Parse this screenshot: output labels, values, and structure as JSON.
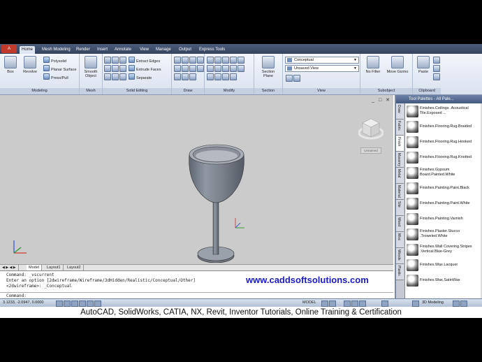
{
  "app": {
    "app_button": "A",
    "tabs": [
      {
        "label": "Home"
      },
      {
        "label": "Mesh Modeling"
      },
      {
        "label": "Render"
      },
      {
        "label": "Insert"
      },
      {
        "label": "Annotate"
      },
      {
        "label": "View"
      },
      {
        "label": "Manage"
      },
      {
        "label": "Output"
      },
      {
        "label": "Express Tools"
      }
    ]
  },
  "ribbon": {
    "modeling": {
      "title": "Modeling",
      "box": "Box",
      "revolve": "Revolve",
      "polysolid": "Polysolid",
      "planar_surface": "Planar Surface",
      "presspull": "Press/Pull"
    },
    "mesh": {
      "title": "Mesh",
      "smooth_object_line1": "Smooth",
      "smooth_object_line2": "Object"
    },
    "solid_editing": {
      "title": "Solid Editing",
      "extract_edges": "Extract Edges",
      "extrude_faces": "Extrude Faces",
      "separate": "Separate"
    },
    "draw": {
      "title": "Draw"
    },
    "modify": {
      "title": "Modify"
    },
    "section": {
      "title": "Section",
      "section_plane_line1": "Section",
      "section_plane_line2": "Plane"
    },
    "view": {
      "title": "View",
      "visual_style": "Conceptual",
      "saved_view": "Unsaved View"
    },
    "subobject": {
      "title": "Subobject",
      "no_filter": "No Filter",
      "move_gizmo": "Move Gizmo"
    },
    "clipboard": {
      "title": "Clipboard",
      "paste": "Paste"
    }
  },
  "viewport": {
    "doc_controls": "_ □ ✕",
    "viewcube_label": "Unnamed"
  },
  "layout_tabs": [
    {
      "label": "Model"
    },
    {
      "label": "Layout1"
    },
    {
      "label": "Layout2"
    }
  ],
  "command": {
    "lines": [
      "Command: _vscurrent",
      "Enter an option [2dwireframe/Wireframe/3dHidden/Realistic/Conceptual/Other]",
      "<2dwireframe>: _Conceptual"
    ],
    "prompt": "Command:"
  },
  "watermark": "www.caddsoftsolutions.com",
  "status": {
    "coords": "3.1233, -2.0947, 0.0000",
    "model": "MODEL",
    "workspace": "3D Modeling"
  },
  "palette": {
    "title": "Tool Palettes - All Pale...",
    "tabs": [
      "Draw",
      "Fabric",
      "Finish",
      "Masonry",
      "Metal",
      "Material",
      "Site",
      "Wood",
      "Misc",
      "Woods",
      "Plastic"
    ],
    "items": [
      "Finishes.Ceilings .Acoustical Tile.Exposed ...",
      "Finishes.Flooring.Rug.Braided",
      "Finishes.Flooring.Rug.Hooked",
      "Finishes.Flooring.Rug.Knotted",
      "Finishes.Gypsum Board.Painted.White",
      "Finishes.Painting.Paint.Black",
      "Finishes.Painting.Paint.White",
      "Finishes.Painting.Varnish",
      "Finishes.Plaster.Stucco .Troweled.White",
      "Finishes.Wall Covering.Stripes .Vertical.Blue-Grey",
      "Finishes.Wax.Lacquer",
      "Finishes.Wax.SatinWax"
    ]
  },
  "caption": "AutoCAD, SolidWorks, CATIA, NX, Revit, Inventor Tutorials, Online Training & Certification"
}
